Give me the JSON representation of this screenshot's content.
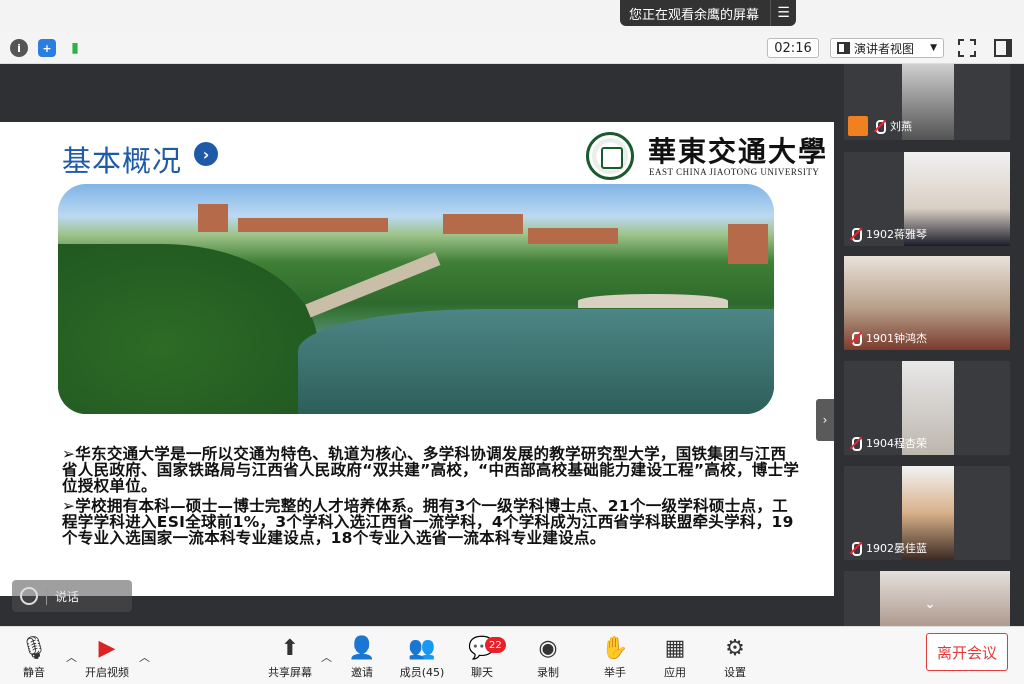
{
  "share_banner": {
    "text": "您正在观看余鹰的屏幕",
    "menu_icon": "list-menu-icon"
  },
  "toolbar": {
    "timer": "02:16",
    "view_mode": "演讲者视图",
    "icons": [
      "info-icon",
      "shield-icon",
      "signal-icon",
      "fullscreen-icon",
      "side-panel-icon"
    ]
  },
  "slide": {
    "title": "基本概况",
    "university_cn": "華東交通大學",
    "university_en": "EAST CHINA JIAOTONG UNIVERSITY",
    "paragraphs": [
      "➢华东交通大学是一所以交通为特色、轨道为核心、多学科协调发展的教学研究型大学，国铁集团与江西省人民政府、国家铁路局与江西省人民政府“双共建”高校，“中西部高校基础能力建设工程”高校，博士学位授权单位。",
      "➢学校拥有本科—硕士—博士完整的人才培养体系。拥有3个一级学科博士点、21个一级学科硕士点，工程学学科进入ESI全球前1%，3个学科入选江西省一流学科，4个学科成为江西省学科联盟牵头学科，19个专业入选国家一流本科专业建设点，18个专业入选省一流本科专业建设点。"
    ]
  },
  "speak_hint": "说话",
  "participants": [
    {
      "name": "刘燕"
    },
    {
      "name": "1902蒋雅琴"
    },
    {
      "name": "1901钟鸿杰"
    },
    {
      "name": "1904程杏荣"
    },
    {
      "name": "1902晏佳蓝"
    }
  ],
  "controls": {
    "mute": "静音",
    "video": "开启视频",
    "share": "共享屏幕",
    "invite": "邀请",
    "members": "成员(45)",
    "chat": "聊天",
    "chat_badge": "22",
    "record": "录制",
    "raise_hand": "举手",
    "apps": "应用",
    "settings": "设置",
    "leave": "离开会议"
  }
}
